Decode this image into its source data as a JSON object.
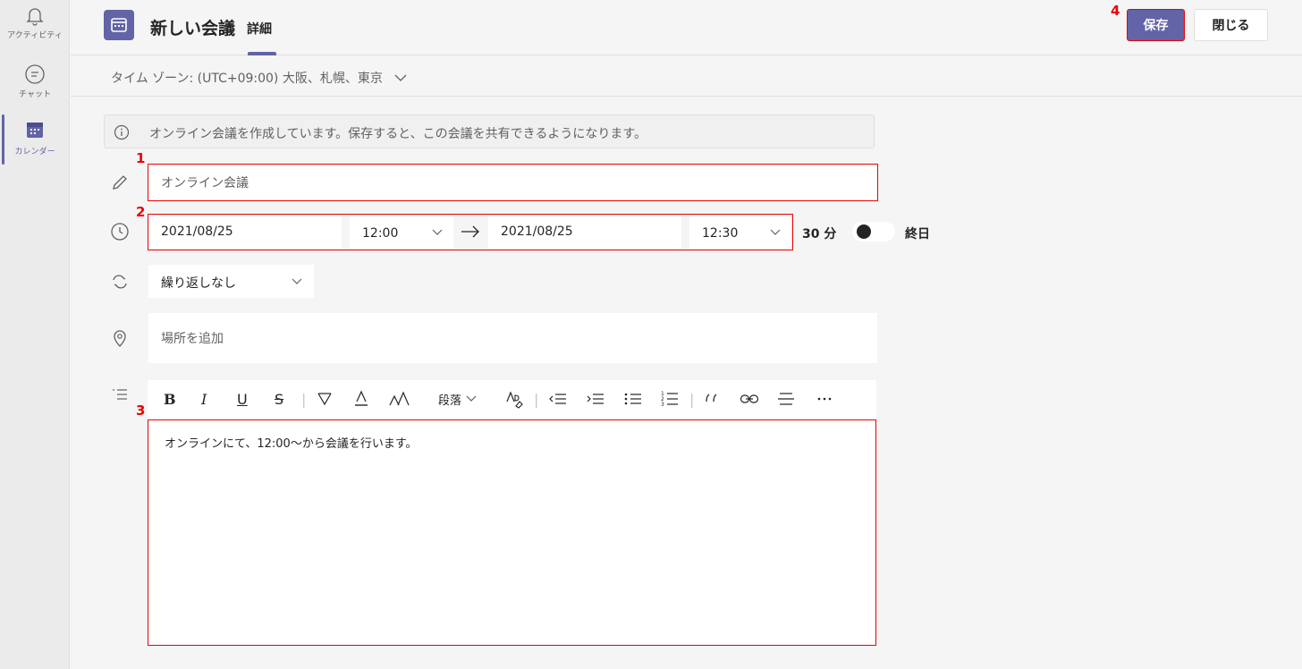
{
  "rail": {
    "items": [
      {
        "label": "アクティビティ",
        "icon": "bell-icon"
      },
      {
        "label": "チャット",
        "icon": "chat-icon"
      },
      {
        "label": "カレンダー",
        "icon": "calendar-icon",
        "active": true
      }
    ]
  },
  "header": {
    "title": "新しい会議",
    "tab_details": "詳細",
    "save_label": "保存",
    "close_label": "閉じる"
  },
  "timezone": "タイム ゾーン: (UTC+09:00) 大阪、札幌、東京",
  "info_banner": "オンライン会議を作成しています。保存すると、この会議を共有できるようになります。",
  "form": {
    "title_value": "オンライン会議",
    "start_date": "2021/08/25",
    "start_time": "12:00",
    "end_date": "2021/08/25",
    "end_time": "12:30",
    "duration": "30 分",
    "all_day_label": "終日",
    "repeat": "繰り返しなし",
    "location_placeholder": "場所を追加",
    "paragraph_label": "段落",
    "body_text": "オンラインにて、12:00～から会議を行います。"
  },
  "annotations": [
    "1",
    "2",
    "3",
    "4"
  ],
  "colors": {
    "accent": "#6264a7",
    "highlight": "#ee0000"
  }
}
